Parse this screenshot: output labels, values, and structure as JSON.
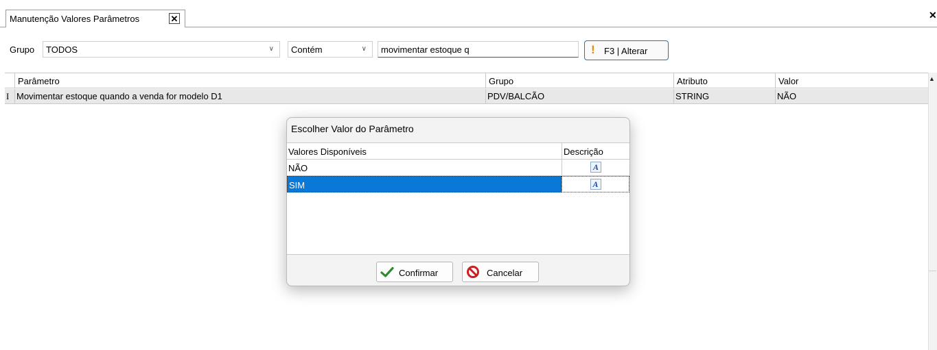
{
  "tab": {
    "title": "Manutenção Valores Parâmetros",
    "close_glyph": "✕"
  },
  "window": {
    "close_glyph": "✕"
  },
  "filter": {
    "grupo_label": "Grupo",
    "grupo_value": "TODOS",
    "operator_value": "Contém",
    "search_value": "movimentar estoque q",
    "alter_button_label": "F3 | Alterar",
    "alter_icon": "exclamation-icon"
  },
  "grid": {
    "columns": [
      "Parâmetro",
      "Grupo",
      "Atributo",
      "Valor"
    ],
    "rows": [
      {
        "indicator": "I",
        "parametro": "Movimentar estoque quando a venda for modelo D1",
        "grupo": "PDV/BALCÃO",
        "atributo": "STRING",
        "valor": "NÃO"
      }
    ]
  },
  "dialog": {
    "title": "Escolher Valor do Parâmetro",
    "columns": [
      "Valores Disponíveis",
      "Descrição"
    ],
    "rows": [
      {
        "value": "NÃO",
        "icon": "format-text-icon",
        "selected": false
      },
      {
        "value": "SIM",
        "icon": "format-text-icon",
        "selected": true
      }
    ],
    "confirm_label": "Confirmar",
    "cancel_label": "Cancelar"
  },
  "colors": {
    "selection": "#0a78d7",
    "accent_border": "#1a73c8",
    "warning_icon": "#e68a00",
    "confirm_icon": "#2e8b2e",
    "cancel_icon": "#cc1f1f"
  }
}
